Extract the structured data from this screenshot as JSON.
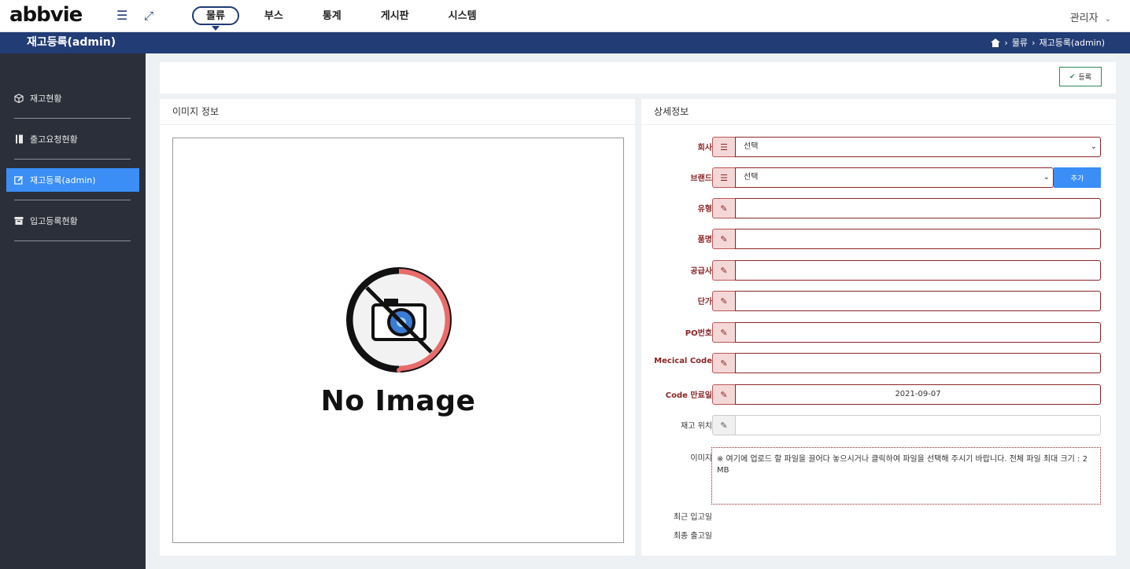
{
  "header": {
    "logo": "abbvie",
    "menu": [
      "물류",
      "부스",
      "통계",
      "게시판",
      "시스템"
    ],
    "active_menu": 0,
    "user": "관리자"
  },
  "titlebar": {
    "title": "재고등록(admin)",
    "breadcrumb": [
      "물류",
      "재고등록(admin)"
    ]
  },
  "sidebar": {
    "items": [
      {
        "label": "재고현황",
        "icon": "box-icon"
      },
      {
        "label": "출고요청현황",
        "icon": "book-icon"
      },
      {
        "label": "재고등록(admin)",
        "icon": "edit-icon"
      },
      {
        "label": "입고등록현황",
        "icon": "archive-icon"
      }
    ],
    "active": 2
  },
  "actions": {
    "register_label": "등록"
  },
  "image_panel": {
    "title": "이미지 정보",
    "placeholder_text": "No Image"
  },
  "detail_panel": {
    "title": "상세정보",
    "fields": {
      "company": {
        "label": "회사",
        "value": "선택"
      },
      "brand": {
        "label": "브랜드",
        "value": "선택",
        "add_label": "추가"
      },
      "type": {
        "label": "유형",
        "value": ""
      },
      "product": {
        "label": "품명",
        "value": ""
      },
      "supplier": {
        "label": "공급사",
        "value": ""
      },
      "price": {
        "label": "단가",
        "value": ""
      },
      "po": {
        "label": "PO번호",
        "value": ""
      },
      "medical_code": {
        "label": "Mecical Code",
        "value": ""
      },
      "code_expiry": {
        "label": "Code 만료일",
        "value": "2021-09-07"
      },
      "location": {
        "label": "재고 위치",
        "value": ""
      }
    },
    "image_label": "이미지",
    "dropzone_text": "※ 여기에 업로드 할 파일을 끌어다 놓으시거나 클릭하여 파일을 선택해 주시기 바랍니다. 전체 파일 최대 크기 : 2 MB",
    "recent_in_label": "최근 입고일",
    "last_out_label": "최종 출고일"
  }
}
